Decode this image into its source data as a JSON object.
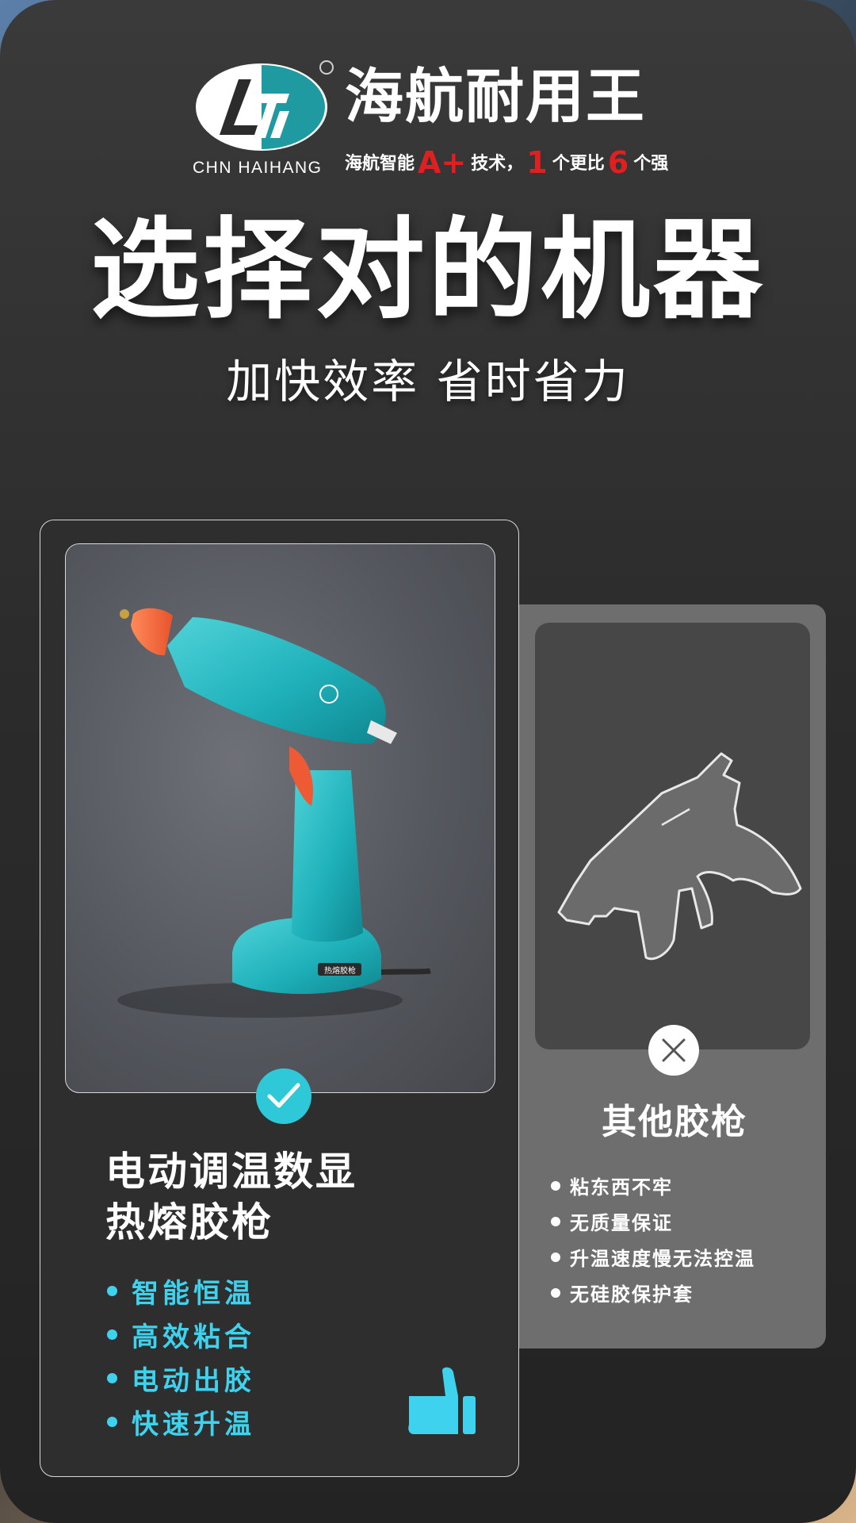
{
  "brand": {
    "logo_text": "CHN HAIHANG",
    "name": "海航耐用王",
    "tagline_prefix": "海航智能",
    "tagline_grade": "A+",
    "tagline_mid": "技术，",
    "tagline_num1": "1",
    "tagline_mid2": "个更比",
    "tagline_num2": "6",
    "tagline_suffix": "个强"
  },
  "headline": "选择对的机器",
  "subheadline": "加快效率 省时省力",
  "featured": {
    "title_line1": "电动调温数显",
    "title_line2": "热熔胶枪",
    "product_label": "热熔胶枪",
    "features": [
      "智能恒温",
      "高效粘合",
      "电动出胶",
      "快速升温"
    ]
  },
  "other": {
    "title": "其他胶枪",
    "drawbacks": [
      "粘东西不牢",
      "无质量保证",
      "升温速度慢无法控温",
      "无硅胶保护套"
    ]
  },
  "icons": {
    "check": "check-icon",
    "cross": "close-icon",
    "thumb": "thumbs-up-icon",
    "logo": "brand-logo-icon"
  },
  "colors": {
    "accent_teal": "#2fc8d8",
    "feature_cyan": "#3fd2ee",
    "tag_red": "#e02020",
    "product_orange": "#ff6a3d"
  }
}
